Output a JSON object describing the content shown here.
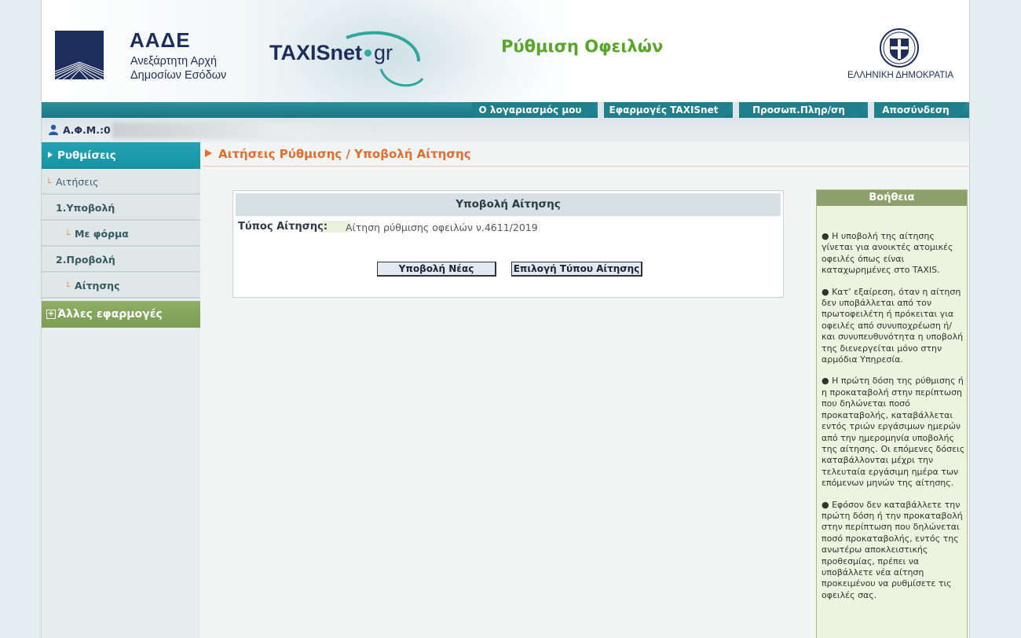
{
  "header": {
    "aade_title": "ΑΑΔΕ",
    "aade_sub1": "Ανεξάρτητη Αρχή",
    "aade_sub2": "Δημοσίων Εσόδων",
    "taxis_main": "TAXISnet",
    "taxis_gr": "gr",
    "app_title": "Ρύθμιση Οφειλών",
    "gov_name": "ΕΛΛΗΝΙΚΗ ΔΗΜΟΚΡΑΤΙΑ"
  },
  "nav": {
    "tabs": [
      {
        "label": "Ο λογαριασμός μου"
      },
      {
        "label": "Εφαρμογές TAXISnet"
      },
      {
        "label": "Προσωπ.Πληρ/ση"
      },
      {
        "label": "Αποσύνδεση"
      }
    ]
  },
  "user": {
    "afm_label": "Α.Φ.Μ.:0"
  },
  "sidebar": {
    "main": "Ρυθμίσεις",
    "items": [
      {
        "label": "Αιτήσεις"
      },
      {
        "label": "1.Υποβολή"
      },
      {
        "label": "Με φόρμα"
      },
      {
        "label": "2.Προβολή"
      },
      {
        "label": "Αίτησης"
      }
    ],
    "other": "Άλλες εφαρμογές"
  },
  "breadcrumb": "Αιτήσεις Ρύθμισης / Υποβολή Αίτησης",
  "panel": {
    "title": "Υποβολή Αίτησης",
    "type_label": "Τύπος Αίτησης:",
    "type_value": "Αίτηση ρύθμισης οφειλών ν.4611/2019",
    "btn_new": "Υποβολή Νέας",
    "btn_select": "Επιλογή Τύπου Αίτησης"
  },
  "help": {
    "title": "Βοήθεια",
    "paragraphs": [
      "● Η υποβολή της αίτησης γίνεται για ανοικτές ατομικές οφειλές όπως είναι καταχωρημένες στο TAXIS.",
      "● Κατ’ εξαίρεση, όταν η αίτηση δεν υποβάλλεται από τον πρωτοφειλέτη ή πρόκειται για οφειλές από συνυποχρέωση ή/και συνυπευθυνότητα η υποβολή της διενεργείται μόνο στην αρμόδια Υπηρεσία.",
      "● Η πρώτη δόση της ρύθμισης ή η προκαταβολή στην περίπτωση που δηλώνεται ποσό προκαταβολής, καταβάλλεται εντός τριών εργάσιμων ημερών από την ημερομηνία υποβολής της αίτησης. Οι επόμενες δόσεις καταβάλλονται μέχρι την τελευταία εργάσιμη ημέρα των επόμενων μηνών της αίτησης.",
      "● Εφόσον δεν καταβάλλετε την πρώτη δόση ή την προκαταβολή στην περίπτωση που δηλώνεται ποσό προκαταβολής, εντός της ανωτέρω αποκλειστικής προθεσμίας, πρέπει να υποβάλλετε νέα αίτηση προκειμένου να ρυθμίσετε τις οφειλές σας."
    ]
  },
  "colors": {
    "accent_teal": "#1f8d9c",
    "title_green": "#58a52a",
    "breadcrumb_orange": "#e26d2e",
    "help_green": "#8d9f6b"
  }
}
